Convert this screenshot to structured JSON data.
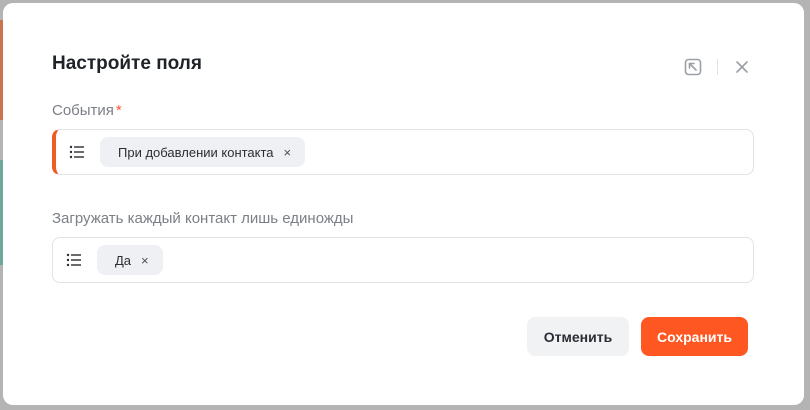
{
  "modal": {
    "title": "Настройте поля"
  },
  "fields": [
    {
      "label": "События",
      "required_mark": "*",
      "chip": "При добавлении контакта",
      "remove": "×"
    },
    {
      "label": "Загружать каждый контакт лишь единожды",
      "chip": "Да",
      "remove": "×"
    }
  ],
  "buttons": {
    "cancel": "Отменить",
    "save": "Сохранить"
  },
  "icons": {
    "header_left": "collapse-arrow-icon",
    "header_right": "close-icon",
    "field": "list-icon"
  },
  "colors": {
    "accent": "#ff5722",
    "invalid": "#f05a24"
  }
}
